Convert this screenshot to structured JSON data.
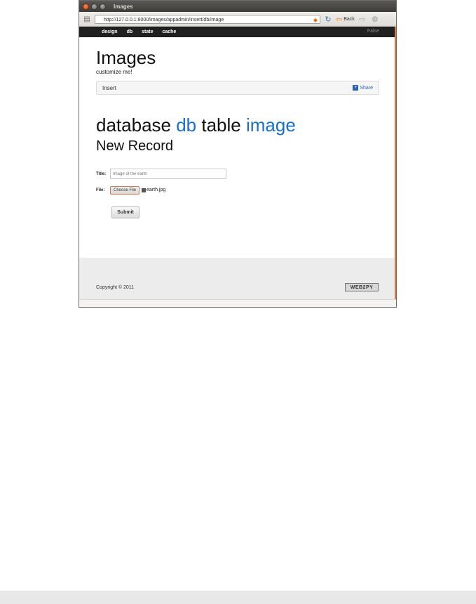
{
  "window": {
    "title": "Images"
  },
  "browser": {
    "url": "http://127.0.0.1:8000/images/appadmin/insert/db/image",
    "back_label": "Back"
  },
  "nav": {
    "items": [
      "design",
      "db",
      "state",
      "cache"
    ],
    "flag": "False"
  },
  "header": {
    "title": "Images",
    "subtitle": "customize me!"
  },
  "breadcrumb": {
    "label": "Insert",
    "share_label": "Share"
  },
  "heading": {
    "prefix": "database",
    "db": "db",
    "middle": "table",
    "table": "image",
    "subheading": "New Record"
  },
  "form": {
    "title_label": "Title:",
    "title_placeholder": "Image of the earth",
    "file_label": "File:",
    "choose_file_label": "Choose File",
    "file_name": "earth.jpg",
    "submit_label": "Submit"
  },
  "footer": {
    "copyright": "Copyright © 2011",
    "powered_by": "WEB2PY"
  },
  "colors": {
    "accent": "#1a70c8",
    "navbar": "#202020",
    "strip": "#e0763c"
  }
}
